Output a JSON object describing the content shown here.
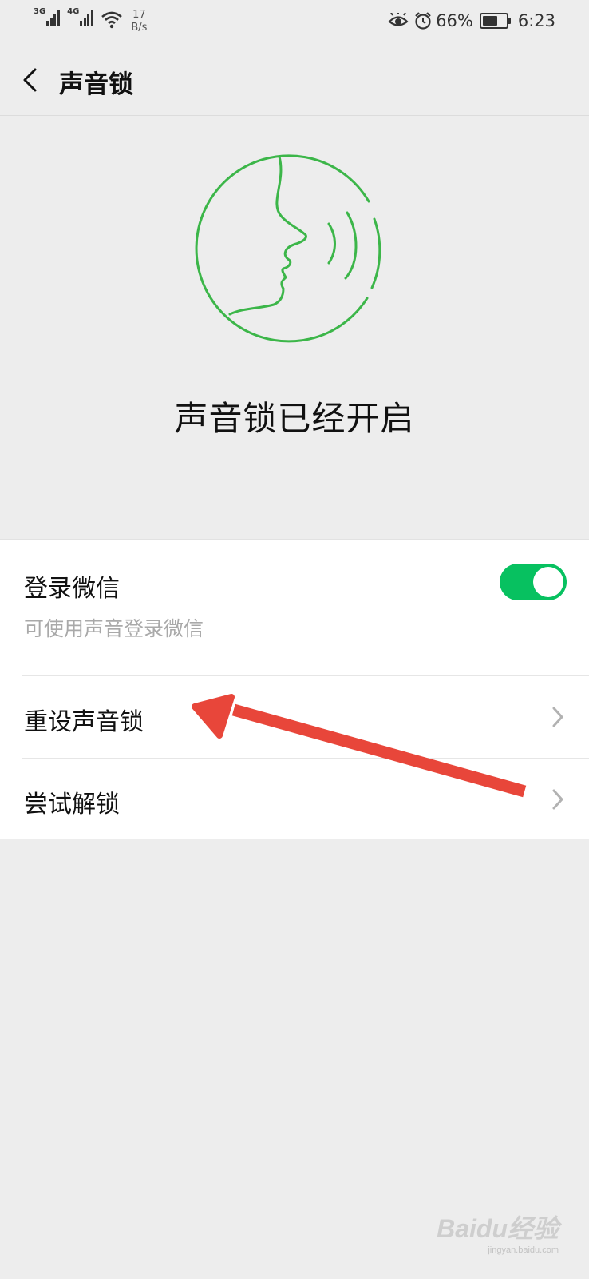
{
  "status_bar": {
    "network_1": "3G",
    "network_2": "4G",
    "speed_value": "17",
    "speed_unit": "B/s",
    "battery_percent": "66%",
    "battery_level": 0.66,
    "time": "6:23",
    "icons": [
      "signal-icon",
      "signal-icon",
      "wifi-icon",
      "eye-comfort-icon",
      "alarm-icon",
      "battery-icon"
    ]
  },
  "nav": {
    "title": "声音锁"
  },
  "hero": {
    "status_text": "声音锁已经开启",
    "illustration_color": "#3cb649"
  },
  "settings": {
    "login": {
      "label": "登录微信",
      "description": "可使用声音登录微信",
      "toggle_on": true,
      "toggle_color": "#07c160"
    },
    "reset": {
      "label": "重设声音锁"
    },
    "try_unlock": {
      "label": "尝试解锁"
    }
  },
  "annotation": {
    "arrow_color": "#e8463a"
  },
  "watermark": {
    "main": "Baidu经验",
    "sub": "jingyan.baidu.com"
  }
}
